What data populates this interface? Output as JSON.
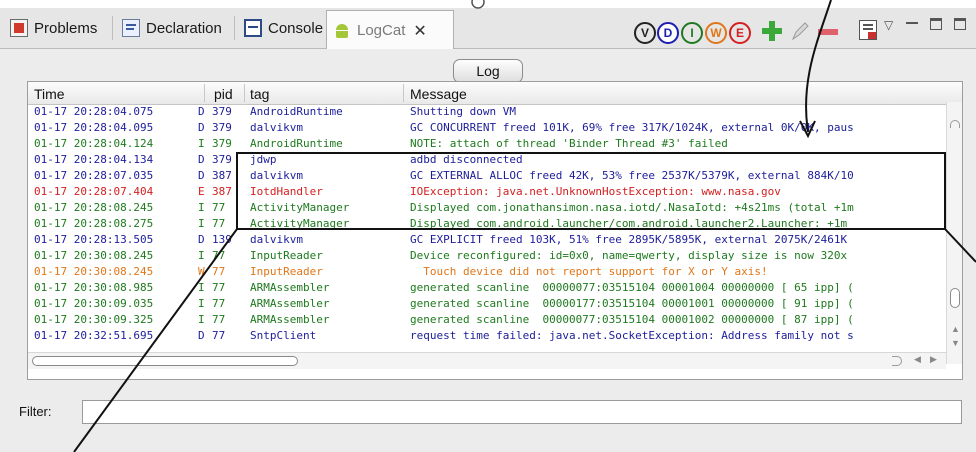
{
  "tabs": [
    {
      "label": "Problems",
      "icon": "problems-icon"
    },
    {
      "label": "Declaration",
      "icon": "declaration-icon"
    },
    {
      "label": "Console",
      "icon": "console-icon"
    },
    {
      "label": "LogCat",
      "icon": "android-icon",
      "active": true
    }
  ],
  "toolbar": {
    "verbose": "V",
    "debug": "D",
    "info": "I",
    "warn": "W",
    "error": "E"
  },
  "log_button": "Log",
  "columns": [
    "Time",
    "pid",
    "tag",
    "Message"
  ],
  "colors": {
    "debug": "#1d1d9a",
    "info": "#1e7a1e",
    "error": "#d42020",
    "warn": "#e0761a",
    "callout": "#111111"
  },
  "rows": [
    {
      "time": "01-17 20:28:04.075",
      "level": "D",
      "pid": "379",
      "tag": "AndroidRuntime",
      "message": "Shutting down VM",
      "kind": "debug"
    },
    {
      "time": "01-17 20:28:04.095",
      "level": "D",
      "pid": "379",
      "tag": "dalvikvm",
      "message": "GC CONCURRENT freed 101K, 69% free 317K/1024K, external 0K/0K, paus",
      "kind": "debug"
    },
    {
      "time": "01-17 20:28:04.124",
      "level": "I",
      "pid": "379",
      "tag": "AndroidRuntime",
      "message": "NOTE: attach of thread 'Binder Thread #3' failed",
      "kind": "info"
    },
    {
      "time": "01-17 20:28:04.134",
      "level": "D",
      "pid": "379",
      "tag": "jdwp",
      "message": "adbd disconnected",
      "kind": "debug"
    },
    {
      "time": "01-17 20:28:07.035",
      "level": "D",
      "pid": "387",
      "tag": "dalvikvm",
      "message": "GC EXTERNAL ALLOC freed 42K, 53% free 2537K/5379K, external 884K/10",
      "kind": "debug"
    },
    {
      "time": "01-17 20:28:07.404",
      "level": "E",
      "pid": "387",
      "tag": "IotdHandler",
      "message": "IOException: java.net.UnknownHostException: www.nasa.gov",
      "kind": "error"
    },
    {
      "time": "01-17 20:28:08.245",
      "level": "I",
      "pid": "77",
      "tag": "ActivityManager",
      "message": "Displayed com.jonathansimon.nasa.iotd/.NasaIotd: +4s21ms (total +1m",
      "kind": "info"
    },
    {
      "time": "01-17 20:28:08.275",
      "level": "I",
      "pid": "77",
      "tag": "ActivityManager",
      "message": "Displayed com.android.launcher/com.android.launcher2.Launcher: +1m",
      "kind": "info"
    },
    {
      "time": "01-17 20:28:13.505",
      "level": "D",
      "pid": "139",
      "tag": "dalvikvm",
      "message": "GC EXPLICIT freed 103K, 51% free 2895K/5895K, external 2075K/2461K",
      "kind": "debug"
    },
    {
      "time": "01-17 20:30:08.245",
      "level": "I",
      "pid": "77",
      "tag": "InputReader",
      "message": "Device reconfigured: id=0x0, name=qwerty, display size is now 320x",
      "kind": "info"
    },
    {
      "time": "01-17 20:30:08.245",
      "level": "W",
      "pid": "77",
      "tag": "InputReader",
      "message": "  Touch device did not report support for X or Y axis!",
      "kind": "warn"
    },
    {
      "time": "01-17 20:30:08.985",
      "level": "I",
      "pid": "77",
      "tag": "ARMAssembler",
      "message": "generated scanline  00000077:03515104 00001004 00000000 [ 65 ipp] (",
      "kind": "info"
    },
    {
      "time": "01-17 20:30:09.035",
      "level": "I",
      "pid": "77",
      "tag": "ARMAssembler",
      "message": "generated scanline  00000177:03515104 00001001 00000000 [ 91 ipp] (",
      "kind": "info"
    },
    {
      "time": "01-17 20:30:09.325",
      "level": "I",
      "pid": "77",
      "tag": "ARMAssembler",
      "message": "generated scanline  00000077:03515104 00001002 00000000 [ 87 ipp] (",
      "kind": "info"
    },
    {
      "time": "01-17 20:32:51.695",
      "level": "D",
      "pid": "77",
      "tag": "SntpClient",
      "message": "request time failed: java.net.SocketException: Address family not s",
      "kind": "debug"
    }
  ],
  "filter_label": "Filter:",
  "filter_value": ""
}
